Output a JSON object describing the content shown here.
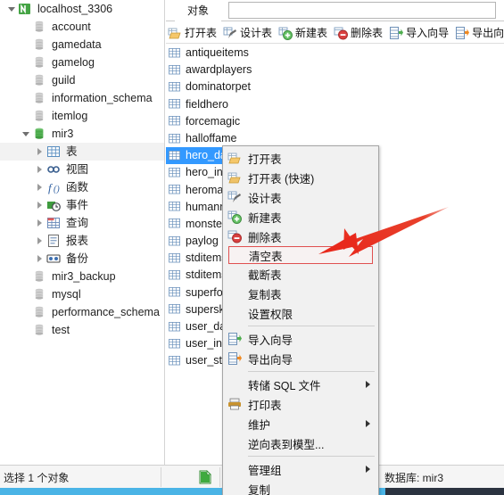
{
  "window": {
    "tab_label": "对象",
    "search_value": ""
  },
  "toolbar": {
    "buttons": [
      {
        "label": "打开表",
        "icon": "open-table-icon"
      },
      {
        "label": "设计表",
        "icon": "design-table-icon"
      },
      {
        "label": "新建表",
        "icon": "new-table-icon"
      },
      {
        "label": "删除表",
        "icon": "delete-table-icon"
      },
      {
        "label": "导入向导",
        "icon": "import-wizard-icon"
      },
      {
        "label": "导出向导",
        "icon": "export-wizard-icon"
      }
    ]
  },
  "sidebar": {
    "items": [
      {
        "label": "localhost_3306",
        "icon": "connection-icon",
        "indent": 0,
        "twisty": "open",
        "selected": false
      },
      {
        "label": "account",
        "icon": "database-icon",
        "indent": 1,
        "twisty": "none",
        "selected": false
      },
      {
        "label": "gamedata",
        "icon": "database-icon",
        "indent": 1,
        "twisty": "none",
        "selected": false
      },
      {
        "label": "gamelog",
        "icon": "database-icon",
        "indent": 1,
        "twisty": "none",
        "selected": false
      },
      {
        "label": "guild",
        "icon": "database-icon",
        "indent": 1,
        "twisty": "none",
        "selected": false
      },
      {
        "label": "information_schema",
        "icon": "database-icon",
        "indent": 1,
        "twisty": "none",
        "selected": false
      },
      {
        "label": "itemlog",
        "icon": "database-icon",
        "indent": 1,
        "twisty": "none",
        "selected": false
      },
      {
        "label": "mir3",
        "icon": "database-open-icon",
        "indent": 1,
        "twisty": "open",
        "selected": false
      },
      {
        "label": "表",
        "icon": "tables-folder-icon",
        "indent": 2,
        "twisty": "closed",
        "selected": true
      },
      {
        "label": "视图",
        "icon": "views-icon",
        "indent": 2,
        "twisty": "closed",
        "selected": false
      },
      {
        "label": "函数",
        "icon": "functions-icon",
        "indent": 2,
        "twisty": "closed",
        "selected": false
      },
      {
        "label": "事件",
        "icon": "events-icon",
        "indent": 2,
        "twisty": "closed",
        "selected": false
      },
      {
        "label": "查询",
        "icon": "queries-icon",
        "indent": 2,
        "twisty": "closed",
        "selected": false
      },
      {
        "label": "报表",
        "icon": "reports-icon",
        "indent": 2,
        "twisty": "closed",
        "selected": false
      },
      {
        "label": "备份",
        "icon": "backup-icon",
        "indent": 2,
        "twisty": "closed",
        "selected": false
      },
      {
        "label": "mir3_backup",
        "icon": "database-icon",
        "indent": 1,
        "twisty": "none",
        "selected": false
      },
      {
        "label": "mysql",
        "icon": "database-icon",
        "indent": 1,
        "twisty": "none",
        "selected": false
      },
      {
        "label": "performance_schema",
        "icon": "database-icon",
        "indent": 1,
        "twisty": "none",
        "selected": false
      },
      {
        "label": "test",
        "icon": "database-icon",
        "indent": 1,
        "twisty": "none",
        "selected": false
      }
    ]
  },
  "objectlist": {
    "rows": [
      {
        "label": "antiqueitems",
        "selected": false
      },
      {
        "label": "awardplayers",
        "selected": false
      },
      {
        "label": "dominatorpet",
        "selected": false
      },
      {
        "label": "fieldhero",
        "selected": false
      },
      {
        "label": "forcemagic",
        "selected": false
      },
      {
        "label": "halloffame",
        "selected": false
      },
      {
        "label": "hero_data",
        "selected": true
      },
      {
        "label": "hero_inc",
        "selected": false
      },
      {
        "label": "heroma",
        "selected": false
      },
      {
        "label": "humann",
        "selected": false
      },
      {
        "label": "monster",
        "selected": false
      },
      {
        "label": "paylog",
        "selected": false
      },
      {
        "label": "stditems",
        "selected": false
      },
      {
        "label": "stditems",
        "selected": false
      },
      {
        "label": "superfo",
        "selected": false
      },
      {
        "label": "supersk",
        "selected": false
      },
      {
        "label": "user_da",
        "selected": false
      },
      {
        "label": "user_inc",
        "selected": false
      },
      {
        "label": "user_std",
        "selected": false
      }
    ]
  },
  "context_menu": {
    "items": [
      {
        "label": "打开表",
        "icon": "open-table-icon",
        "type": "item",
        "submenu": false,
        "highlighted": false
      },
      {
        "label": "打开表 (快速)",
        "icon": "open-table-fast-icon",
        "type": "item",
        "submenu": false,
        "highlighted": false
      },
      {
        "label": "设计表",
        "icon": "design-table-icon",
        "type": "item",
        "submenu": false,
        "highlighted": false
      },
      {
        "label": "新建表",
        "icon": "new-table-icon",
        "type": "item",
        "submenu": false,
        "highlighted": false
      },
      {
        "label": "删除表",
        "icon": "delete-table-icon",
        "type": "item",
        "submenu": false,
        "highlighted": false
      },
      {
        "label": "清空表",
        "icon": "none",
        "type": "item",
        "submenu": false,
        "highlighted": true
      },
      {
        "label": "截断表",
        "icon": "none",
        "type": "item",
        "submenu": false,
        "highlighted": false
      },
      {
        "label": "复制表",
        "icon": "none",
        "type": "item",
        "submenu": false,
        "highlighted": false
      },
      {
        "label": "设置权限",
        "icon": "none",
        "type": "item",
        "submenu": false,
        "highlighted": false
      },
      {
        "label": "",
        "icon": "none",
        "type": "separator",
        "submenu": false,
        "highlighted": false
      },
      {
        "label": "导入向导",
        "icon": "import-wizard-icon",
        "type": "item",
        "submenu": false,
        "highlighted": false
      },
      {
        "label": "导出向导",
        "icon": "export-wizard-icon",
        "type": "item",
        "submenu": false,
        "highlighted": false
      },
      {
        "label": "",
        "icon": "none",
        "type": "separator",
        "submenu": false,
        "highlighted": false
      },
      {
        "label": "转储 SQL 文件",
        "icon": "none",
        "type": "item",
        "submenu": true,
        "highlighted": false
      },
      {
        "label": "打印表",
        "icon": "print-icon",
        "type": "item",
        "submenu": false,
        "highlighted": false
      },
      {
        "label": "维护",
        "icon": "none",
        "type": "item",
        "submenu": true,
        "highlighted": false
      },
      {
        "label": "逆向表到模型...",
        "icon": "none",
        "type": "item",
        "submenu": false,
        "highlighted": false
      },
      {
        "label": "",
        "icon": "none",
        "type": "separator",
        "submenu": false,
        "highlighted": false
      },
      {
        "label": "管理组",
        "icon": "none",
        "type": "item",
        "submenu": true,
        "highlighted": false
      },
      {
        "label": "复制",
        "icon": "none",
        "type": "item",
        "submenu": false,
        "highlighted": false
      }
    ]
  },
  "statusbar": {
    "selection_text": "选择 1 个对象",
    "database_text": "数据库: mir3"
  },
  "colors": {
    "selection_blue": "#3399ff",
    "annotation_red": "#e8291c",
    "highlight_border": "#e05050",
    "taskbar_blue": "#4ab4e6"
  }
}
